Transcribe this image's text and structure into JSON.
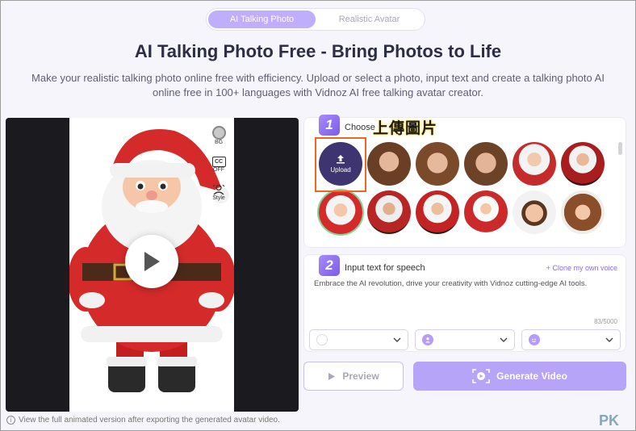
{
  "tabs": [
    {
      "label": "AI Talking Photo",
      "active": true
    },
    {
      "label": "Realistic Avatar",
      "active": false
    }
  ],
  "title": "AI Talking Photo Free - Bring Photos to Life",
  "subtitle": "Make your realistic talking photo online free with efficiency. Upload or select a photo, input text and create a talking photo AI online free in 100+ languages with Vidnoz AI free talking avatar creator.",
  "preview": {
    "controls": {
      "bg": "BG",
      "cc": "CC",
      "cc_state": "OFF",
      "style": "Style"
    },
    "footnote": "View the full animated version after exporting the generated avatar video."
  },
  "step1": {
    "number": "1",
    "label": "Choose",
    "upload_label": "Upload",
    "annotation": "上傳圖片",
    "avatars": [
      "girl-1",
      "girl-2",
      "girl-3",
      "santa-1",
      "santa-2",
      "santa-3d",
      "santa-4",
      "santa-5",
      "santa-6",
      "boy-3d",
      "woman-3d"
    ]
  },
  "step2": {
    "number": "2",
    "label": "Input text for speech",
    "clone_link": "+ Clone my own voice",
    "text": "Embrace the AI revolution, drive your creativity with Vidnoz cutting-edge AI tools.",
    "counter": "83/5000"
  },
  "buttons": {
    "preview": "Preview",
    "generate": "Generate Video"
  },
  "watermark": "PK",
  "colors": {
    "accent": "#b6a4f9",
    "highlight": "#f26522",
    "step": "#8c6cf1"
  }
}
